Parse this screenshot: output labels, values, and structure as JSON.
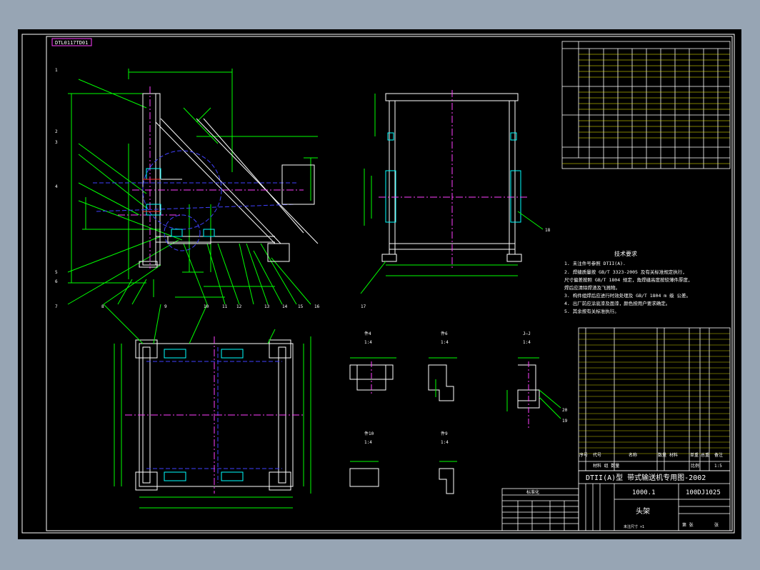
{
  "drawing_code": "DTL0117TD01",
  "title_block": {
    "series_title": "DTII(A)型  带式输送机专用图-2002",
    "drawing_number": "1000.1",
    "part_number": "100DJ1025",
    "part_name": "头架",
    "material_row": "材料  组  数量",
    "scale_label": "比例",
    "scale": "1:5",
    "sheet_label": "张",
    "sheet_of": "第  张"
  },
  "tech_requirements": {
    "heading": "技术要求",
    "items": [
      "1. 未注件号参照 DTII(A).",
      "2. 焊缝质量按 GB/T 3323-2005 及有关标准规定执行，",
      "   尺寸偏差按照 GB/T 1804 规定，角焊缝高度按较薄件厚度，",
      "   焊后应清除焊渣及飞溅物。",
      "3. 构件组焊后应进行时效处理及 GB/T 1804 m 级 公差。",
      "4. 出厂前应涂底漆及面漆，颜色按用户要求确定。",
      "5. 其余按有关标准执行。"
    ]
  },
  "section_labels": [
    "件4",
    "件6",
    "J—J",
    "件10",
    "件9"
  ],
  "section_scales": [
    "1:4",
    "1:4",
    "1:4",
    "1:4",
    "1:4"
  ],
  "item_numbers": [
    "1",
    "2",
    "3",
    "4",
    "5",
    "6",
    "7",
    "8",
    "9",
    "10",
    "11",
    "12",
    "13",
    "14",
    "15",
    "16",
    "17",
    "18",
    "19",
    "20"
  ],
  "dimension_top": "1:4",
  "parts_list_header": [
    "序号",
    "代号",
    "名称",
    "数量",
    "材料",
    "单重",
    "总重",
    "备注"
  ],
  "stamp_title": "标准化",
  "legend_note": "未注尺寸 ×1"
}
